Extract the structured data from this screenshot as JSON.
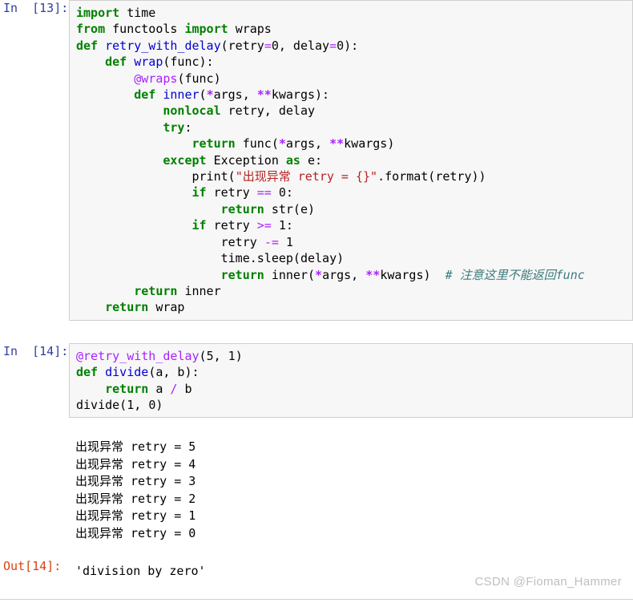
{
  "notebook": {
    "cells": [
      {
        "type": "code",
        "prompt": "In  [13]:",
        "source_lines": [
          "import time",
          "from functools import wraps",
          "def retry_with_delay(retry=0, delay=0):",
          "    def wrap(func):",
          "        @wraps(func)",
          "        def inner(*args, **kwargs):",
          "            nonlocal retry, delay",
          "            try:",
          "                return func(*args, **kwargs)",
          "            except Exception as e:",
          "                print(\"出现异常 retry = {}\".format(retry))",
          "                if retry == 0:",
          "                    return str(e)",
          "                if retry >= 1:",
          "                    retry -= 1",
          "                    time.sleep(delay)",
          "                    return inner(*args, **kwargs)  # 注意这里不能返回func",
          "        return inner",
          "    return wrap"
        ]
      },
      {
        "type": "code",
        "prompt": "In  [14]:",
        "source_lines": [
          "@retry_with_delay(5, 1)",
          "def divide(a, b):",
          "    return a / b",
          "divide(1, 0)"
        ]
      }
    ],
    "stdout_lines": [
      "出现异常 retry = 5",
      "出现异常 retry = 4",
      "出现异常 retry = 3",
      "出现异常 retry = 2",
      "出现异常 retry = 1",
      "出现异常 retry = 0"
    ],
    "result": {
      "prompt": "Out[14]:",
      "value": "'division by zero'"
    }
  },
  "watermark": {
    "text": "CSDN @Fioman_Hammer"
  },
  "colors": {
    "keyword": "#008000",
    "function": "#0000d2",
    "decorator": "#aa22ff",
    "string": "#ba2121",
    "operator": "#aa22ff",
    "comment": "#3d7b7b",
    "prompt_in": "#303f9f",
    "prompt_out": "#d84315",
    "cell_background": "#f7f7f7",
    "cell_border": "#cfcfcf",
    "watermark": "#bfbfbf"
  }
}
